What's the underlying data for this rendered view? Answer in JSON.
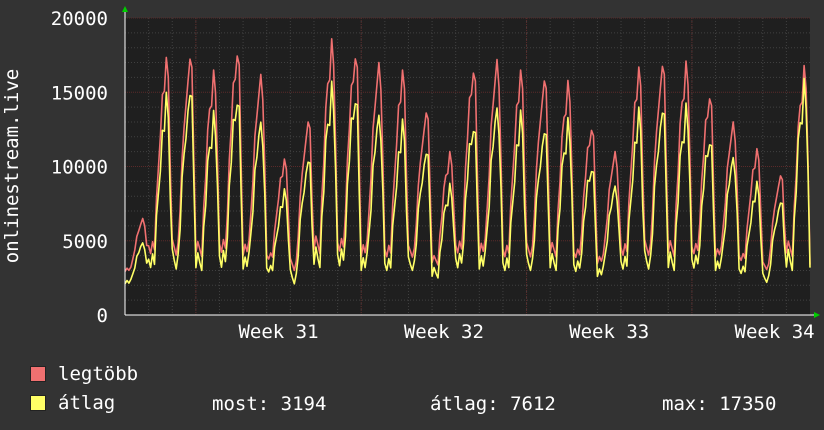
{
  "colors": {
    "background": "#333333",
    "plot_background": "#1f1f1f",
    "grid_major": "#5a2a2a",
    "grid_minor": "#404040",
    "max_series": "#f07070",
    "avg_series": "#ffff66",
    "arrow": "#00cc00",
    "text": "#ffffff"
  },
  "legend": {
    "max_label": "legtöbb",
    "avg_label": "átlag"
  },
  "stats": {
    "now": "most: 3194",
    "avg": "átlag: 7612",
    "max": "max: 17350"
  },
  "chart_data": {
    "type": "line",
    "title": "",
    "ylabel": "onlinestream.live",
    "xlabel": "",
    "ylim": [
      0,
      20000
    ],
    "yticks": [
      "20000",
      "15000",
      "10000",
      "5000",
      "0"
    ],
    "ytick_values": [
      20000,
      15000,
      10000,
      5000,
      0
    ],
    "xtick_labels": [
      "Week 31",
      "Week 32",
      "Week 33",
      "Week 34"
    ],
    "grid": true,
    "days": 29,
    "samples_per_day": 12,
    "x_range_days": [
      0,
      29
    ],
    "week_boundaries_days": [
      3,
      10,
      17,
      24
    ],
    "week_label_centers_days": [
      6.5,
      13.5,
      20.5,
      27.5
    ],
    "daily_min_max": [
      6500,
      17350,
      17500,
      16500,
      18000,
      16200,
      10500,
      13200,
      18600,
      17800,
      17000,
      16500,
      13800,
      11000,
      16800,
      17200,
      16500,
      16000,
      15800,
      12800,
      11000,
      16700,
      17000,
      17100,
      15000,
      13000,
      11200,
      9500,
      16800
    ],
    "daily_avg_peak": [
      5000,
      15000,
      15800,
      14000,
      15500,
      13500,
      8500,
      11000,
      16000,
      15600,
      14000,
      13200,
      11500,
      9000,
      13500,
      14500,
      13800,
      13000,
      13500,
      10500,
      9000,
      14000,
      14500,
      14500,
      12500,
      11000,
      9000,
      8000,
      16200
    ],
    "daily_trough": [
      2100,
      3200,
      3100,
      3000,
      3000,
      3100,
      2900,
      2100,
      3200,
      3100,
      3000,
      3000,
      3000,
      2500,
      3000,
      3100,
      3000,
      3000,
      3000,
      2800,
      2600,
      3100,
      3100,
      3000,
      3000,
      3000,
      2800,
      2200,
      3000
    ],
    "series": [
      {
        "name": "legtöbb",
        "color": "#f07070"
      },
      {
        "name": "átlag",
        "color": "#ffff66"
      }
    ],
    "current": 3194,
    "average": 7612,
    "maximum": 17350
  }
}
